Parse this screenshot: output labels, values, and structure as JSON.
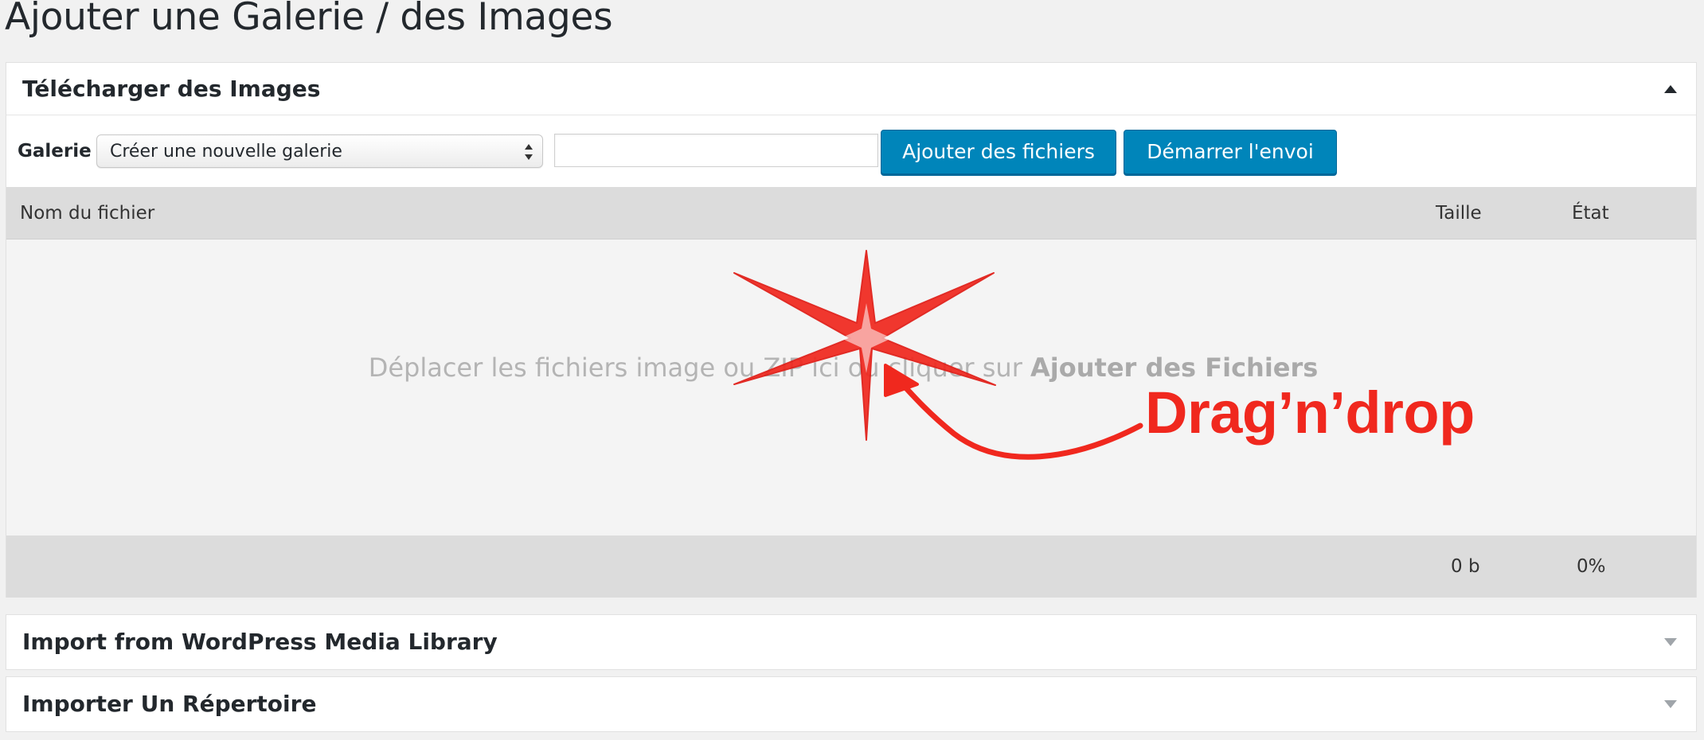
{
  "page": {
    "title": "Ajouter une Galerie / des Images"
  },
  "upload_panel": {
    "title": "Télécharger des Images",
    "gallery_label": "Galerie",
    "gallery_select_value": "Créer une nouvelle galerie",
    "gallery_name_value": "",
    "add_files_label": "Ajouter des fichiers",
    "start_upload_label": "Démarrer l'envoi",
    "columns": {
      "filename": "Nom du fichier",
      "size": "Taille",
      "status": "État"
    },
    "drop_text_prefix": "Déplacer les fichiers image ou ZIP ici ou cliquer sur ",
    "drop_text_bold": "Ajouter des Fichiers",
    "total_size": "0 b",
    "total_percent": "0%"
  },
  "annotation": {
    "label": "Drag’n’drop",
    "color": "#f0281e"
  },
  "panels": {
    "media_library_title": "Import from WordPress Media Library",
    "directory_title": "Importer Un Répertoire"
  },
  "colors": {
    "primary_button": "#0085ba",
    "background": "#f1f1f1",
    "table_header": "#dcdcdc"
  },
  "icons": {
    "collapse": "caret-up-icon",
    "expand": "caret-down-icon",
    "select": "select-arrows-icon"
  }
}
